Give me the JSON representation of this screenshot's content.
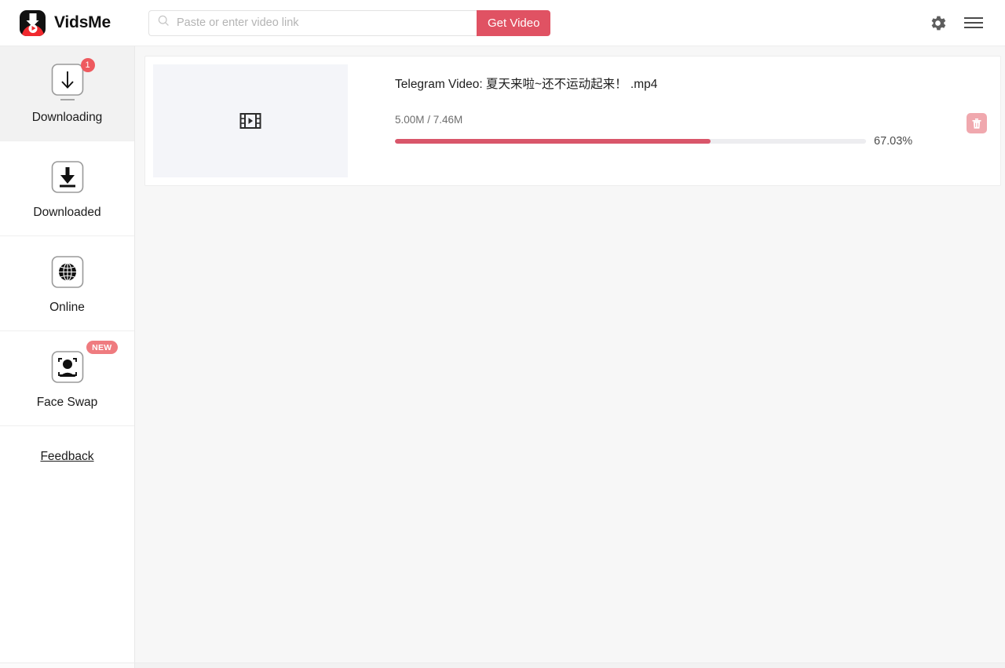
{
  "app": {
    "brand_name": "VidsMe",
    "logo_icon": "vidsme-logo-icon",
    "accent_color": "#e05263",
    "badge_color": "#ee5a5f",
    "progress_color": "#d9566a",
    "sidebar_active_bg": "#f2f2f2",
    "main_bg": "#f7f7f7",
    "thumb_bg": "#f4f5f9"
  },
  "search": {
    "placeholder": "Paste or enter video link",
    "value": "",
    "icon": "search-icon",
    "button_label": "Get Video"
  },
  "topbar": {
    "settings_icon": "gear-icon",
    "menu_icon": "hamburger-menu-icon"
  },
  "sidebar": {
    "items": [
      {
        "label": "Downloading",
        "icon": "downloading-arrow-icon",
        "badge": "1",
        "badge_type": "count",
        "active": true
      },
      {
        "label": "Downloaded",
        "icon": "downloaded-arrow-icon",
        "badge": "",
        "badge_type": "none",
        "active": false
      },
      {
        "label": "Online",
        "icon": "globe-icon",
        "badge": "",
        "badge_type": "none",
        "active": false
      },
      {
        "label": "Face Swap",
        "icon": "face-swap-icon",
        "badge": "NEW",
        "badge_type": "new",
        "active": false
      }
    ],
    "feedback_label": "Feedback"
  },
  "downloads": [
    {
      "title": "Telegram Video: 夏天来啦~还不运动起来！ .mp4",
      "size_text": "5.00M / 7.46M",
      "downloaded": "5.00M",
      "total": "7.46M",
      "progress_percent": 67.03,
      "progress_label": "67.03%",
      "thumbnail_icon": "film-play-icon",
      "delete_icon": "trash-icon"
    }
  ]
}
